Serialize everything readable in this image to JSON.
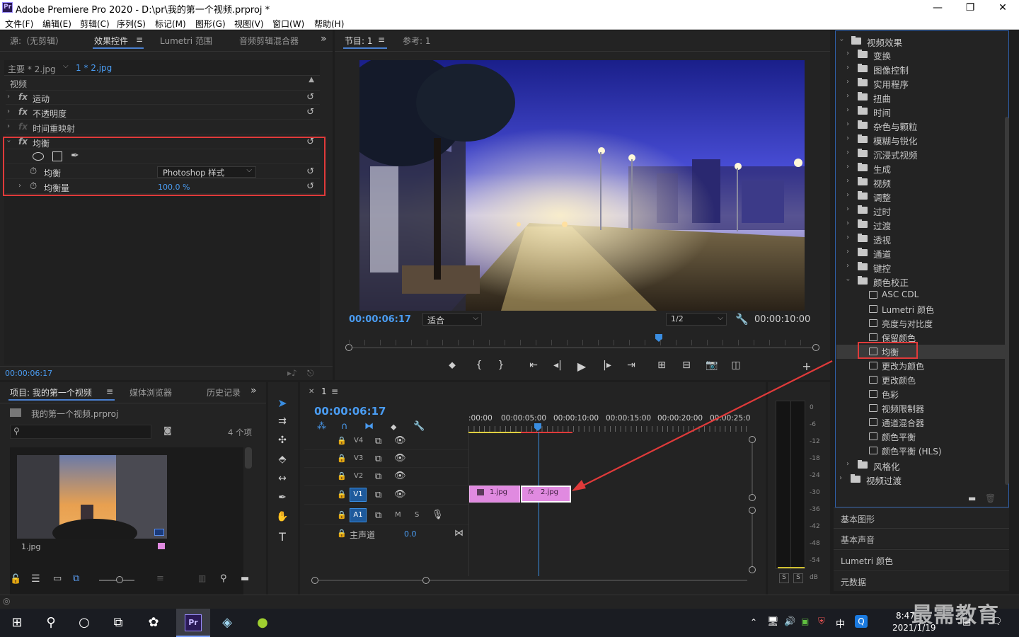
{
  "window": {
    "title": "Adobe Premiere Pro 2020 - D:\\pr\\我的第一个视频.prproj *",
    "app_icon": "Pr",
    "minimize": "—",
    "maximize": "❐",
    "close": "✕"
  },
  "menu": [
    "文件(F)",
    "编辑(E)",
    "剪辑(C)",
    "序列(S)",
    "标记(M)",
    "图形(G)",
    "视图(V)",
    "窗口(W)",
    "帮助(H)"
  ],
  "source_panel": {
    "tabs": [
      "源:（无剪辑）",
      "效果控件",
      "Lumetri 范围",
      "音频剪辑混合器"
    ],
    "active_tab": "效果控件",
    "overflow": "»",
    "master_clip": "主要 * 2.jpg",
    "clip": "1 * 2.jpg",
    "section": "视频",
    "effects": [
      {
        "name": "运动"
      },
      {
        "name": "不透明度"
      },
      {
        "name": "时间重映射"
      },
      {
        "name": "均衡"
      }
    ],
    "equalize": {
      "param1_label": "均衡",
      "param1_value": "Photoshop 样式",
      "param2_label": "均衡量",
      "param2_value": "100.0 %"
    },
    "timecode": "00:00:06:17"
  },
  "program_monitor": {
    "tab": "节目: 1",
    "ref_tab": "参考: 1",
    "timecode": "00:00:06:17",
    "fit": "适合",
    "resolution": "1/2",
    "duration": "00:00:10:00"
  },
  "project_panel": {
    "tabs": [
      "项目: 我的第一个视频",
      "媒体浏览器",
      "历史记录"
    ],
    "active_tab": "项目: 我的第一个视频",
    "file": "我的第一个视频.prproj",
    "item_count": "4 个项",
    "thumb_label": "1.jpg"
  },
  "timeline": {
    "tab": "1",
    "timecode": "00:00:06:17",
    "ruler": [
      ":00:00",
      "00:00:05:00",
      "00:00:10:00",
      "00:00:15:00",
      "00:00:20:00",
      "00:00:25:00"
    ],
    "tracks": [
      "V4",
      "V3",
      "V2",
      "V1",
      "A1"
    ],
    "master": "主声道",
    "master_value": "0.0",
    "clips": [
      "1.jpg",
      "2.jpg"
    ],
    "mute": "M",
    "solo": "S"
  },
  "effects_panel": {
    "root": "视频效果",
    "folders": [
      "变换",
      "图像控制",
      "实用程序",
      "扭曲",
      "时间",
      "杂色与颗粒",
      "模糊与锐化",
      "沉浸式视频",
      "生成",
      "视频",
      "调整",
      "过时",
      "过渡",
      "透视",
      "通道",
      "键控"
    ],
    "open_folder": "颜色校正",
    "color_effects": [
      "ASC CDL",
      "Lumetri 颜色",
      "亮度与对比度",
      "保留颜色",
      "均衡",
      "更改为颜色",
      "更改颜色",
      "色彩",
      "视频限制器",
      "通道混合器",
      "颜色平衡",
      "颜色平衡 (HLS)"
    ],
    "selected": "均衡",
    "after": "风格化",
    "transitions": "视频过渡"
  },
  "side_sections": [
    "基本图形",
    "基本声音",
    "Lumetri 颜色",
    "元数据"
  ],
  "vu_scale": [
    "0",
    "-6",
    "-12",
    "-18",
    "-24",
    "-30",
    "-36",
    "-42",
    "-48",
    "-54",
    "dB"
  ],
  "vu_solo": [
    "S",
    "S"
  ],
  "taskbar": {
    "time": "8:47",
    "date": "2021/1/19",
    "ime": "中"
  },
  "watermark": "最需教育"
}
